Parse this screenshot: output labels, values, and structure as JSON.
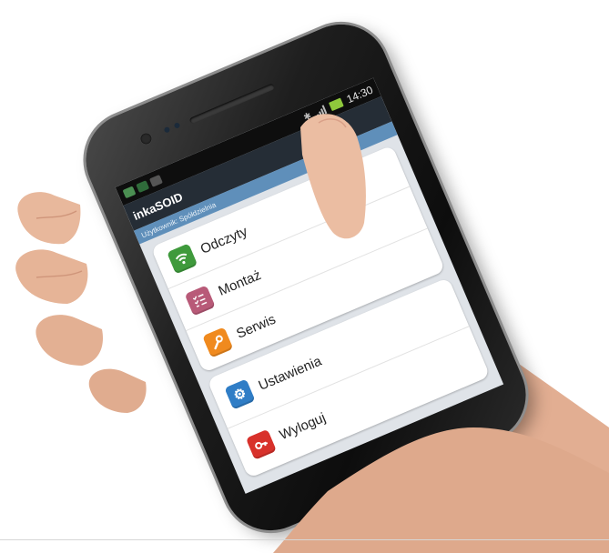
{
  "status_bar": {
    "time": "14:30",
    "icons": [
      "notification-icon",
      "notification-icon",
      "notification-icon",
      "bluetooth-icon",
      "signal-icon",
      "battery-icon"
    ]
  },
  "app": {
    "title": "inkaSOID",
    "subtitle": "Użytkownik: Spółdzielnia"
  },
  "menu": {
    "groups": [
      {
        "items": [
          {
            "label": "Odczyty",
            "icon": "wifi-icon",
            "color": "#3f9a3c"
          },
          {
            "label": "Montaż",
            "icon": "checklist-icon",
            "color": "#b85a78"
          },
          {
            "label": "Serwis",
            "icon": "wrench-icon",
            "color": "#f08a1e"
          }
        ]
      },
      {
        "items": [
          {
            "label": "Ustawienia",
            "icon": "gear-icon",
            "color": "#2f7dc6"
          },
          {
            "label": "Wyloguj",
            "icon": "key-icon",
            "color": "#d8312b"
          }
        ]
      }
    ]
  },
  "colors": {
    "appbar": "#252d36",
    "subbar": "#5f8fba",
    "screen_bg": "#dfe3e8",
    "skin": "#e7b69b"
  }
}
